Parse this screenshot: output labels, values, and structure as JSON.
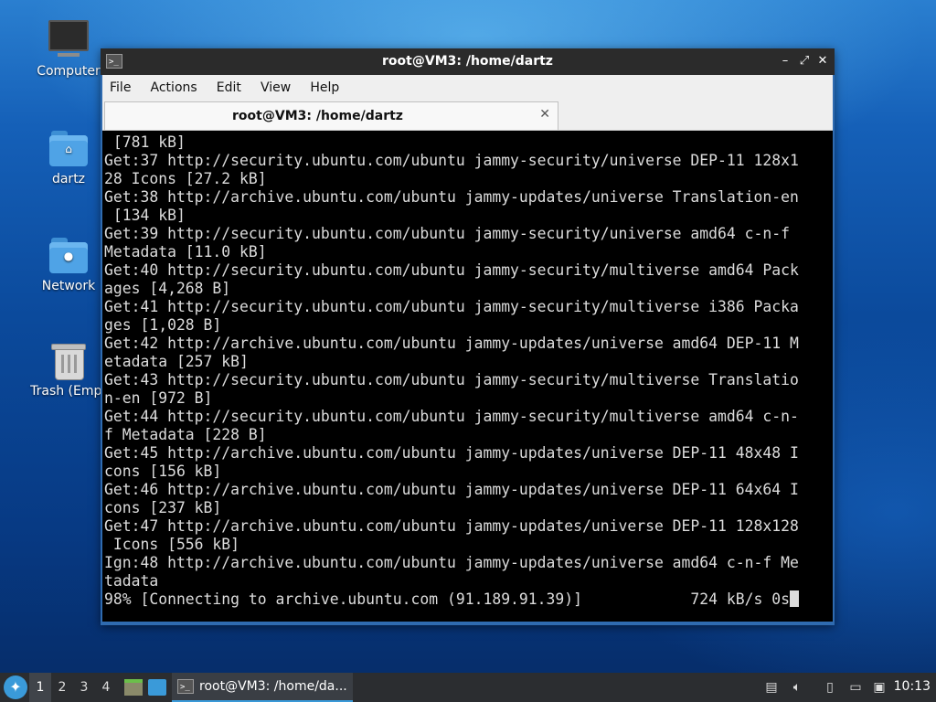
{
  "desktop": {
    "icons": [
      {
        "label": "Computer"
      },
      {
        "label": "dartz"
      },
      {
        "label": "Network"
      },
      {
        "label": "Trash (Empt"
      }
    ]
  },
  "window": {
    "title": "root@VM3: /home/dartz",
    "menu": [
      "File",
      "Actions",
      "Edit",
      "View",
      "Help"
    ],
    "tab": {
      "label": "root@VM3: /home/dartz"
    },
    "controls": {
      "minimize": "–",
      "maximize": "⤢",
      "close": "✕"
    },
    "terminal_lines": [
      " [781 kB]",
      "Get:37 http://security.ubuntu.com/ubuntu jammy-security/universe DEP-11 128x1",
      "28 Icons [27.2 kB]",
      "Get:38 http://archive.ubuntu.com/ubuntu jammy-updates/universe Translation-en",
      " [134 kB]",
      "Get:39 http://security.ubuntu.com/ubuntu jammy-security/universe amd64 c-n-f",
      "Metadata [11.0 kB]",
      "Get:40 http://security.ubuntu.com/ubuntu jammy-security/multiverse amd64 Pack",
      "ages [4,268 B]",
      "Get:41 http://security.ubuntu.com/ubuntu jammy-security/multiverse i386 Packa",
      "ges [1,028 B]",
      "Get:42 http://archive.ubuntu.com/ubuntu jammy-updates/universe amd64 DEP-11 M",
      "etadata [257 kB]",
      "Get:43 http://security.ubuntu.com/ubuntu jammy-security/multiverse Translatio",
      "n-en [972 B]",
      "Get:44 http://security.ubuntu.com/ubuntu jammy-security/multiverse amd64 c-n-",
      "f Metadata [228 B]",
      "Get:45 http://archive.ubuntu.com/ubuntu jammy-updates/universe DEP-11 48x48 I",
      "cons [156 kB]",
      "Get:46 http://archive.ubuntu.com/ubuntu jammy-updates/universe DEP-11 64x64 I",
      "cons [237 kB]",
      "Get:47 http://archive.ubuntu.com/ubuntu jammy-updates/universe DEP-11 128x128",
      " Icons [556 kB]",
      "Ign:48 http://archive.ubuntu.com/ubuntu jammy-updates/universe amd64 c-n-f Me",
      "tadata"
    ],
    "progress_line": "98% [Connecting to archive.ubuntu.com (91.189.91.39)]            724 kB/s 0s"
  },
  "taskbar": {
    "workspaces": [
      "1",
      "2",
      "3",
      "4"
    ],
    "active_workspace": "1",
    "task_label": "root@VM3: /home/da...",
    "clock": "10:13",
    "colors": {
      "accent": "#3a9ad9",
      "panel": "#2b2d30"
    }
  }
}
